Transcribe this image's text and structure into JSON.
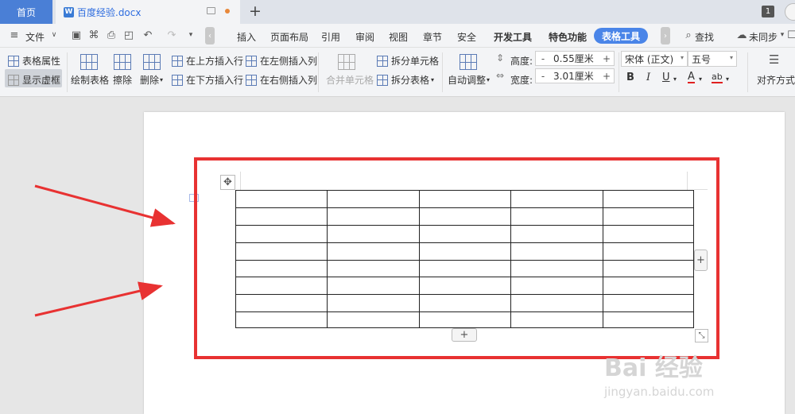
{
  "tabs": {
    "home": "首页",
    "document": "百度经验.docx",
    "doc_icon_letter": "W",
    "new_tab": "+"
  },
  "window": {
    "badge": "1"
  },
  "menu": {
    "file": "文件",
    "items": [
      "插入",
      "页面布局",
      "引用",
      "审阅",
      "视图",
      "章节",
      "安全",
      "开发工具",
      "特色功能"
    ],
    "active": "表格工具",
    "search": "查找",
    "sync": "未同步"
  },
  "ribbon": {
    "table_properties": "表格属性",
    "show_gridlines": "显示虚框",
    "draw_table": "绘制表格",
    "erase": "擦除",
    "delete": "删除",
    "insert_above": "在上方插入行",
    "insert_below": "在下方插入行",
    "insert_left": "在左侧插入列",
    "insert_right": "在右侧插入列",
    "merge_cells": "合并单元格",
    "split_cells": "拆分单元格",
    "split_table": "拆分表格",
    "auto_fit": "自动调整",
    "height_label": "高度:",
    "height_value": "0.55厘米",
    "width_label": "宽度:",
    "width_value": "3.01厘米",
    "font_name": "宋体 (正文)",
    "font_size": "五号",
    "align": "对齐方式"
  },
  "table": {
    "rows": 8,
    "columns": 5
  },
  "watermark": {
    "line1": "Bai  经验",
    "line2": "jingyan.baidu.com"
  },
  "colors": {
    "accent": "#4a85e8",
    "highlight": "#e83232",
    "arrow": "#e83232"
  }
}
